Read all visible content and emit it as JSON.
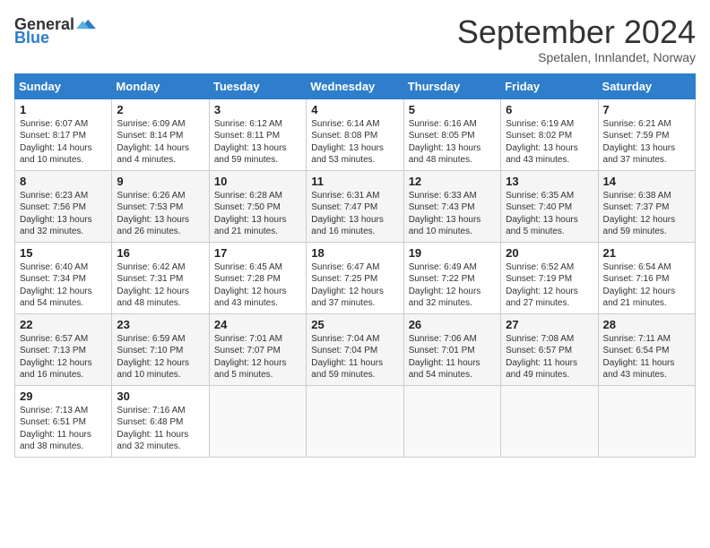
{
  "header": {
    "logo": {
      "general": "General",
      "blue": "Blue"
    },
    "title": "September 2024",
    "subtitle": "Spetalen, Innlandet, Norway"
  },
  "columns": [
    "Sunday",
    "Monday",
    "Tuesday",
    "Wednesday",
    "Thursday",
    "Friday",
    "Saturday"
  ],
  "weeks": [
    [
      {
        "day": "1",
        "sunrise": "6:07 AM",
        "sunset": "8:17 PM",
        "daylight": "14 hours and 10 minutes."
      },
      {
        "day": "2",
        "sunrise": "6:09 AM",
        "sunset": "8:14 PM",
        "daylight": "14 hours and 4 minutes."
      },
      {
        "day": "3",
        "sunrise": "6:12 AM",
        "sunset": "8:11 PM",
        "daylight": "13 hours and 59 minutes."
      },
      {
        "day": "4",
        "sunrise": "6:14 AM",
        "sunset": "8:08 PM",
        "daylight": "13 hours and 53 minutes."
      },
      {
        "day": "5",
        "sunrise": "6:16 AM",
        "sunset": "8:05 PM",
        "daylight": "13 hours and 48 minutes."
      },
      {
        "day": "6",
        "sunrise": "6:19 AM",
        "sunset": "8:02 PM",
        "daylight": "13 hours and 43 minutes."
      },
      {
        "day": "7",
        "sunrise": "6:21 AM",
        "sunset": "7:59 PM",
        "daylight": "13 hours and 37 minutes."
      }
    ],
    [
      {
        "day": "8",
        "sunrise": "6:23 AM",
        "sunset": "7:56 PM",
        "daylight": "13 hours and 32 minutes."
      },
      {
        "day": "9",
        "sunrise": "6:26 AM",
        "sunset": "7:53 PM",
        "daylight": "13 hours and 26 minutes."
      },
      {
        "day": "10",
        "sunrise": "6:28 AM",
        "sunset": "7:50 PM",
        "daylight": "13 hours and 21 minutes."
      },
      {
        "day": "11",
        "sunrise": "6:31 AM",
        "sunset": "7:47 PM",
        "daylight": "13 hours and 16 minutes."
      },
      {
        "day": "12",
        "sunrise": "6:33 AM",
        "sunset": "7:43 PM",
        "daylight": "13 hours and 10 minutes."
      },
      {
        "day": "13",
        "sunrise": "6:35 AM",
        "sunset": "7:40 PM",
        "daylight": "13 hours and 5 minutes."
      },
      {
        "day": "14",
        "sunrise": "6:38 AM",
        "sunset": "7:37 PM",
        "daylight": "12 hours and 59 minutes."
      }
    ],
    [
      {
        "day": "15",
        "sunrise": "6:40 AM",
        "sunset": "7:34 PM",
        "daylight": "12 hours and 54 minutes."
      },
      {
        "day": "16",
        "sunrise": "6:42 AM",
        "sunset": "7:31 PM",
        "daylight": "12 hours and 48 minutes."
      },
      {
        "day": "17",
        "sunrise": "6:45 AM",
        "sunset": "7:28 PM",
        "daylight": "12 hours and 43 minutes."
      },
      {
        "day": "18",
        "sunrise": "6:47 AM",
        "sunset": "7:25 PM",
        "daylight": "12 hours and 37 minutes."
      },
      {
        "day": "19",
        "sunrise": "6:49 AM",
        "sunset": "7:22 PM",
        "daylight": "12 hours and 32 minutes."
      },
      {
        "day": "20",
        "sunrise": "6:52 AM",
        "sunset": "7:19 PM",
        "daylight": "12 hours and 27 minutes."
      },
      {
        "day": "21",
        "sunrise": "6:54 AM",
        "sunset": "7:16 PM",
        "daylight": "12 hours and 21 minutes."
      }
    ],
    [
      {
        "day": "22",
        "sunrise": "6:57 AM",
        "sunset": "7:13 PM",
        "daylight": "12 hours and 16 minutes."
      },
      {
        "day": "23",
        "sunrise": "6:59 AM",
        "sunset": "7:10 PM",
        "daylight": "12 hours and 10 minutes."
      },
      {
        "day": "24",
        "sunrise": "7:01 AM",
        "sunset": "7:07 PM",
        "daylight": "12 hours and 5 minutes."
      },
      {
        "day": "25",
        "sunrise": "7:04 AM",
        "sunset": "7:04 PM",
        "daylight": "11 hours and 59 minutes."
      },
      {
        "day": "26",
        "sunrise": "7:06 AM",
        "sunset": "7:01 PM",
        "daylight": "11 hours and 54 minutes."
      },
      {
        "day": "27",
        "sunrise": "7:08 AM",
        "sunset": "6:57 PM",
        "daylight": "11 hours and 49 minutes."
      },
      {
        "day": "28",
        "sunrise": "7:11 AM",
        "sunset": "6:54 PM",
        "daylight": "11 hours and 43 minutes."
      }
    ],
    [
      {
        "day": "29",
        "sunrise": "7:13 AM",
        "sunset": "6:51 PM",
        "daylight": "11 hours and 38 minutes."
      },
      {
        "day": "30",
        "sunrise": "7:16 AM",
        "sunset": "6:48 PM",
        "daylight": "11 hours and 32 minutes."
      },
      null,
      null,
      null,
      null,
      null
    ]
  ],
  "labels": {
    "sunrise": "Sunrise:",
    "sunset": "Sunset:",
    "daylight": "Daylight:"
  }
}
